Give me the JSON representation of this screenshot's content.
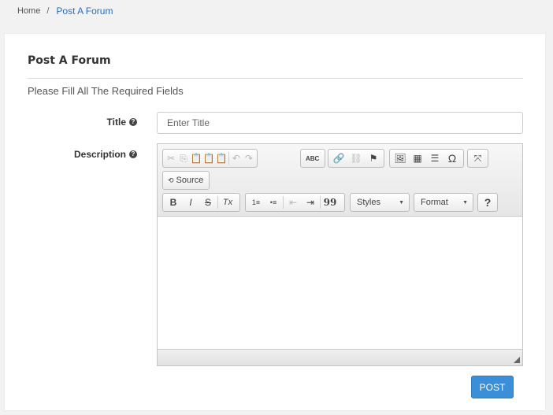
{
  "breadcrumb": {
    "home": "Home",
    "separator": "/",
    "current": "Post A Forum"
  },
  "form": {
    "heading": "Post A Forum",
    "instructions": "Please Fill All The Required Fields",
    "title_label": "Title",
    "title_placeholder": "Enter Title",
    "title_value": "",
    "description_label": "Description",
    "help_glyph": "?",
    "submit_label": "POST"
  },
  "editor": {
    "source_label": "Source",
    "styles_combo": "Styles",
    "format_combo": "Format",
    "help_button": "?",
    "content": ""
  },
  "icons": {
    "cut": "✂",
    "copy": "⎘",
    "paste": "📋",
    "undo": "↶",
    "redo": "↷",
    "spellcheck": "ABC",
    "link": "🔗",
    "unlink": "⛓",
    "anchor": "⚑",
    "image": "🖼",
    "table": "▦",
    "hr": "☰",
    "special_char": "Ω",
    "maximize": "⤧",
    "source": "⟲",
    "bold": "B",
    "italic": "I",
    "strike": "S",
    "remove_format": "Tx",
    "ordered_list": "1≡",
    "bulleted_list": "•≡",
    "outdent": "⇤",
    "indent": "⇥",
    "blockquote": "99"
  },
  "colors": {
    "accent": "#3a8fd8",
    "link": "#2a6ebb"
  }
}
